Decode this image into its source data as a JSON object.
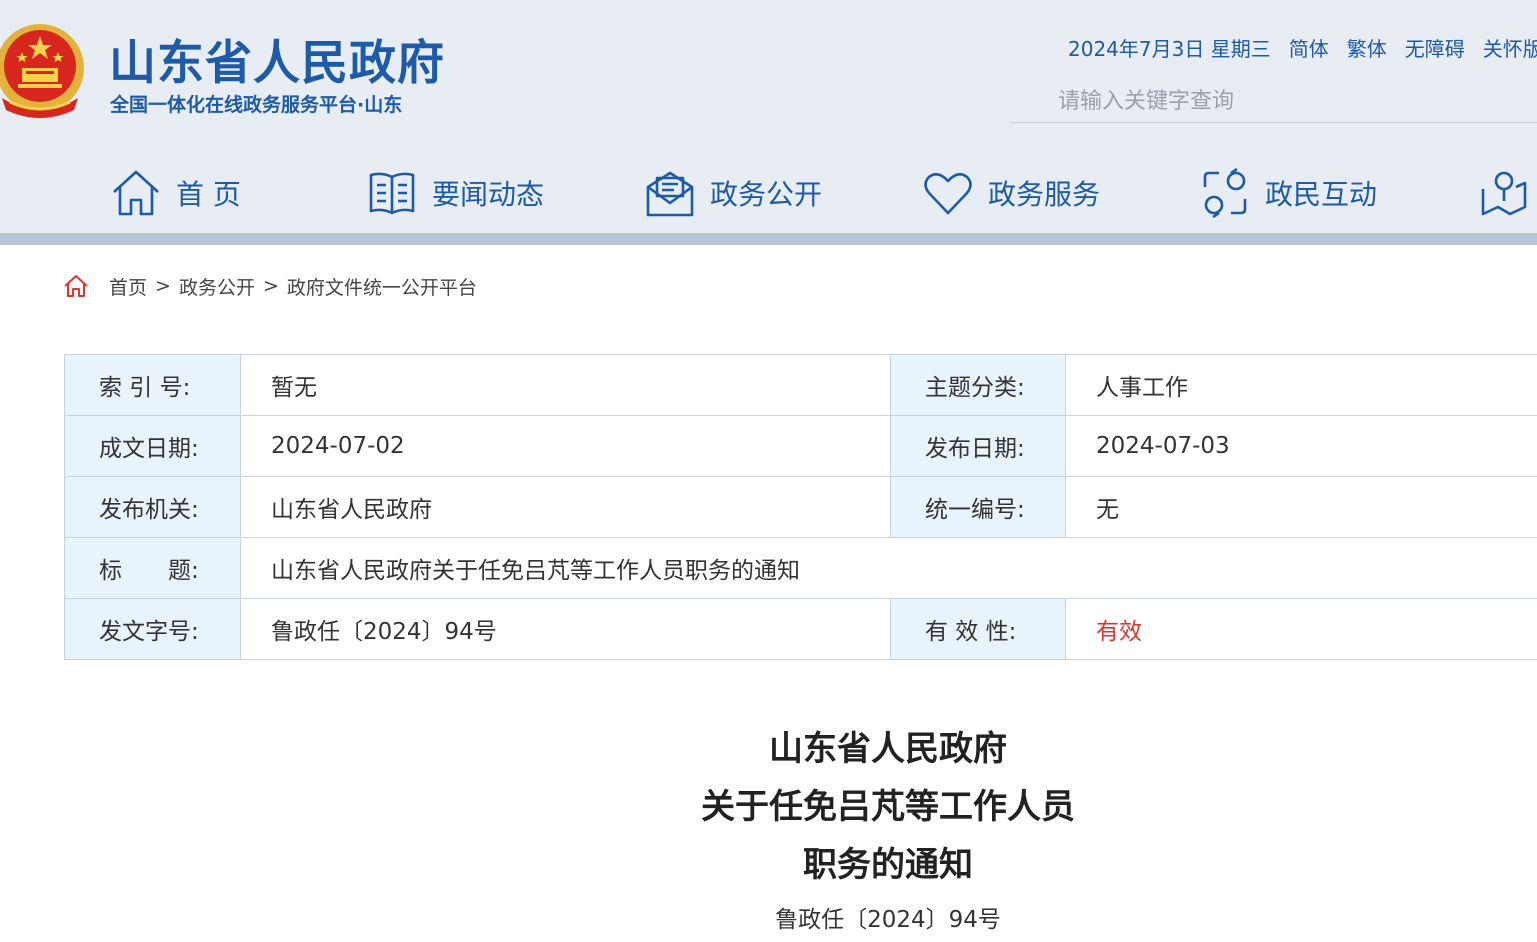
{
  "header": {
    "title": "山东省人民政府",
    "subtitle": "全国一体化在线政务服务平台·山东",
    "emblem_icon": "national-emblem-icon",
    "top_links": {
      "date": "2024年7月3日 星期三",
      "simplified": "简体",
      "traditional": "繁体",
      "accessibility": "无障碍",
      "elderly": "关怀版"
    },
    "search": {
      "placeholder": "请输入关键字查询",
      "value": ""
    }
  },
  "nav": {
    "items": [
      {
        "label": "首 页",
        "icon": "home-icon"
      },
      {
        "label": "要闻动态",
        "icon": "book-icon"
      },
      {
        "label": "政务公开",
        "icon": "mail-icon"
      },
      {
        "label": "政务服务",
        "icon": "heart-icon"
      },
      {
        "label": "政民互动",
        "icon": "interaction-icon"
      },
      {
        "label": "",
        "icon": "location-user-icon"
      }
    ]
  },
  "breadcrumb": {
    "items": [
      "首页",
      "政务公开",
      "政府文件统一公开平台"
    ],
    "separator": ">"
  },
  "meta": {
    "index_label": "索 引 号:",
    "index_value": "暂无",
    "topic_label": "主题分类:",
    "topic_value": "人事工作",
    "written_date_label": "成文日期:",
    "written_date_value": "2024-07-02",
    "publish_date_label": "发布日期:",
    "publish_date_value": "2024-07-03",
    "issuer_label": "发布机关:",
    "issuer_value": "山东省人民政府",
    "uniform_number_label": "统一编号:",
    "uniform_number_value": "无",
    "title_label": "标　　题:",
    "title_value": "山东省人民政府关于任免吕芃等工作人员职务的通知",
    "doc_number_label": "发文字号:",
    "doc_number_value": "鲁政任〔2024〕94号",
    "validity_label": "有 效 性:",
    "validity_value": "有效"
  },
  "document": {
    "title_line1": "山东省人民政府",
    "title_line2": "关于任免吕芃等工作人员",
    "title_line3": "职务的通知",
    "number": "鲁政任〔2024〕94号"
  },
  "colors": {
    "brand": "#1d5aa8",
    "header_bg": "#e8ecf3",
    "label_bg": "#e8f3fb",
    "valid_red": "#d9372c"
  }
}
